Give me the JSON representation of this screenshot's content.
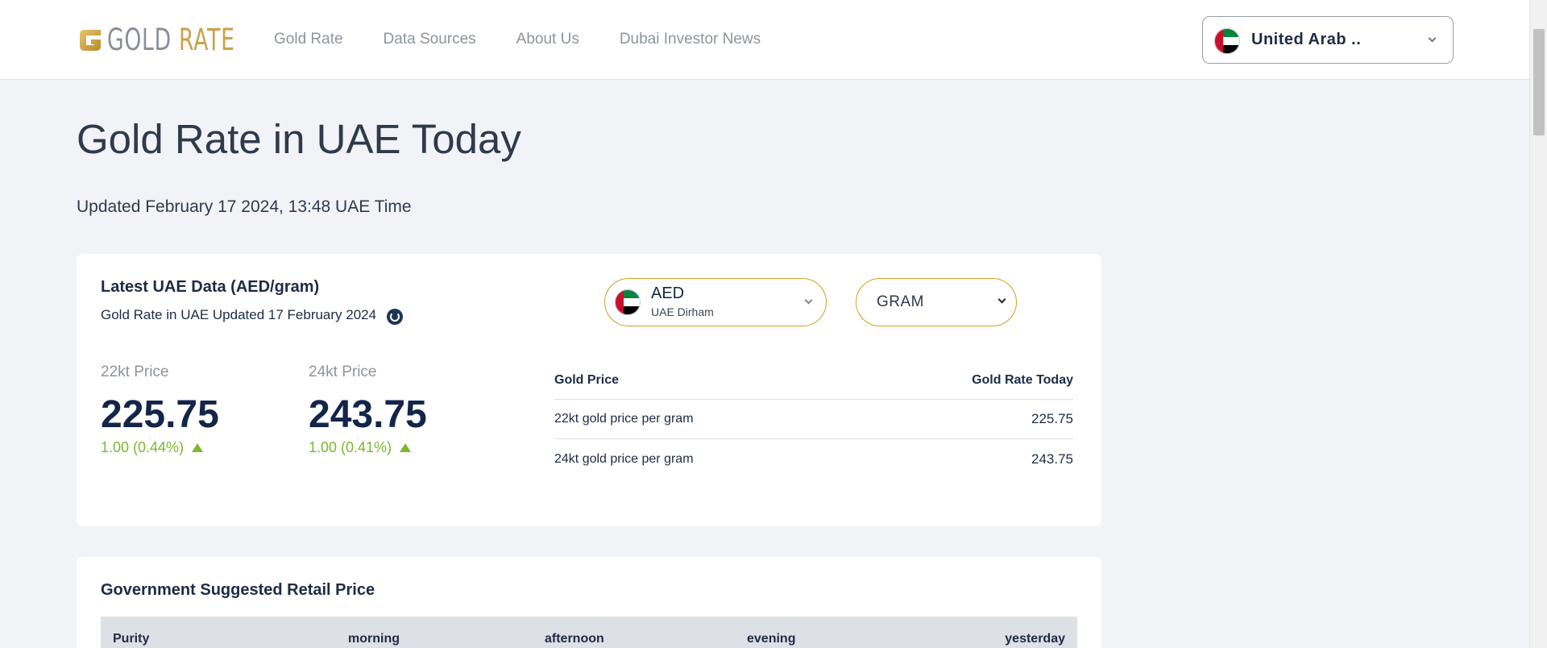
{
  "brand": {
    "logo_word1": "GOLD",
    "logo_word2": "RATE",
    "logo_letter": "G"
  },
  "nav": [
    {
      "label": "Gold Rate"
    },
    {
      "label": "Data Sources"
    },
    {
      "label": "About Us"
    },
    {
      "label": "Dubai Investor News"
    }
  ],
  "country_select": {
    "value": "United Arab .."
  },
  "page": {
    "title": "Gold Rate in UAE Today",
    "updated": "Updated February 17 2024, 13:48 UAE Time"
  },
  "latest": {
    "title": "Latest UAE Data (AED/gram)",
    "subtitle": "Gold Rate in UAE Updated 17 February 2024",
    "k22": {
      "label": "22kt Price",
      "value": "225.75",
      "change": "1.00 (0.44%)"
    },
    "k24": {
      "label": "24kt Price",
      "value": "243.75",
      "change": "1.00 (0.41%)"
    },
    "currency": {
      "code": "AED",
      "name": "UAE Dirham"
    },
    "unit": "GRAM",
    "table": {
      "col1": "Gold Price",
      "col2": "Gold Rate Today",
      "rows": [
        {
          "label": "22kt gold price per gram",
          "value": "225.75"
        },
        {
          "label": "24kt gold price per gram",
          "value": "243.75"
        }
      ]
    }
  },
  "retail": {
    "title": "Government Suggested Retail Price",
    "headers": [
      "Purity",
      "morning",
      "afternoon",
      "evening",
      "yesterday"
    ]
  },
  "colors": {
    "gold": "#c9a227",
    "navy": "#14254a",
    "up": "#7cb82f",
    "bg": "#f1f3f6"
  },
  "icons": {
    "refresh": "refresh-icon",
    "flag": "uae-flag-icon",
    "chevron": "chevron-down-icon",
    "trend": "triangle-up-icon"
  }
}
